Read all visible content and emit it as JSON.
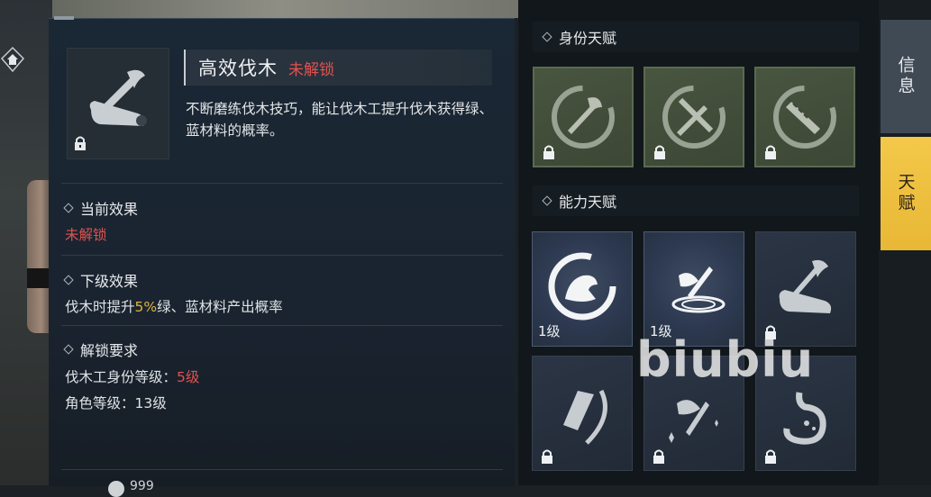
{
  "talent": {
    "name": "高效伐木",
    "status": "未解锁",
    "description": "不断磨练伐木技巧，能让伐木工提升伐木获得绿、蓝材料的概率。"
  },
  "current_effect": {
    "label": "当前效果",
    "value": "未解锁"
  },
  "next_effect": {
    "label": "下级效果",
    "prefix": "伐木时提升",
    "highlight": "5%",
    "suffix": "绿、蓝材料产出概率"
  },
  "unlock": {
    "label": "解锁要求",
    "req1_label": "伐木工身份等级：",
    "req1_value": "5级",
    "req2": "角色等级：13级"
  },
  "identity_section": {
    "title": "身份天赋",
    "items": [
      {
        "icon": "axe-circle-icon",
        "locked": true
      },
      {
        "icon": "axe-crossed-icon",
        "locked": true
      },
      {
        "icon": "saw-circle-icon",
        "locked": true
      }
    ]
  },
  "ability_section": {
    "title": "能力天赋",
    "items": [
      {
        "icon": "strength-arm-icon",
        "level": "1级"
      },
      {
        "icon": "axe-chop-icon",
        "level": "1级"
      },
      {
        "icon": "axe-log-icon",
        "locked": true
      },
      {
        "icon": "chainsaw-icon",
        "locked": true
      },
      {
        "icon": "axe-sparkle-icon",
        "locked": true
      },
      {
        "icon": "stomach-icon",
        "locked": true
      }
    ]
  },
  "side_tabs": {
    "info": "信息",
    "talent": "天赋"
  },
  "watermark": "biubiu",
  "bottom_count": "999",
  "colors": {
    "locked_red": "#e0524f",
    "highlight_yellow": "#e3b43d",
    "active_tab": "#f0c245"
  }
}
